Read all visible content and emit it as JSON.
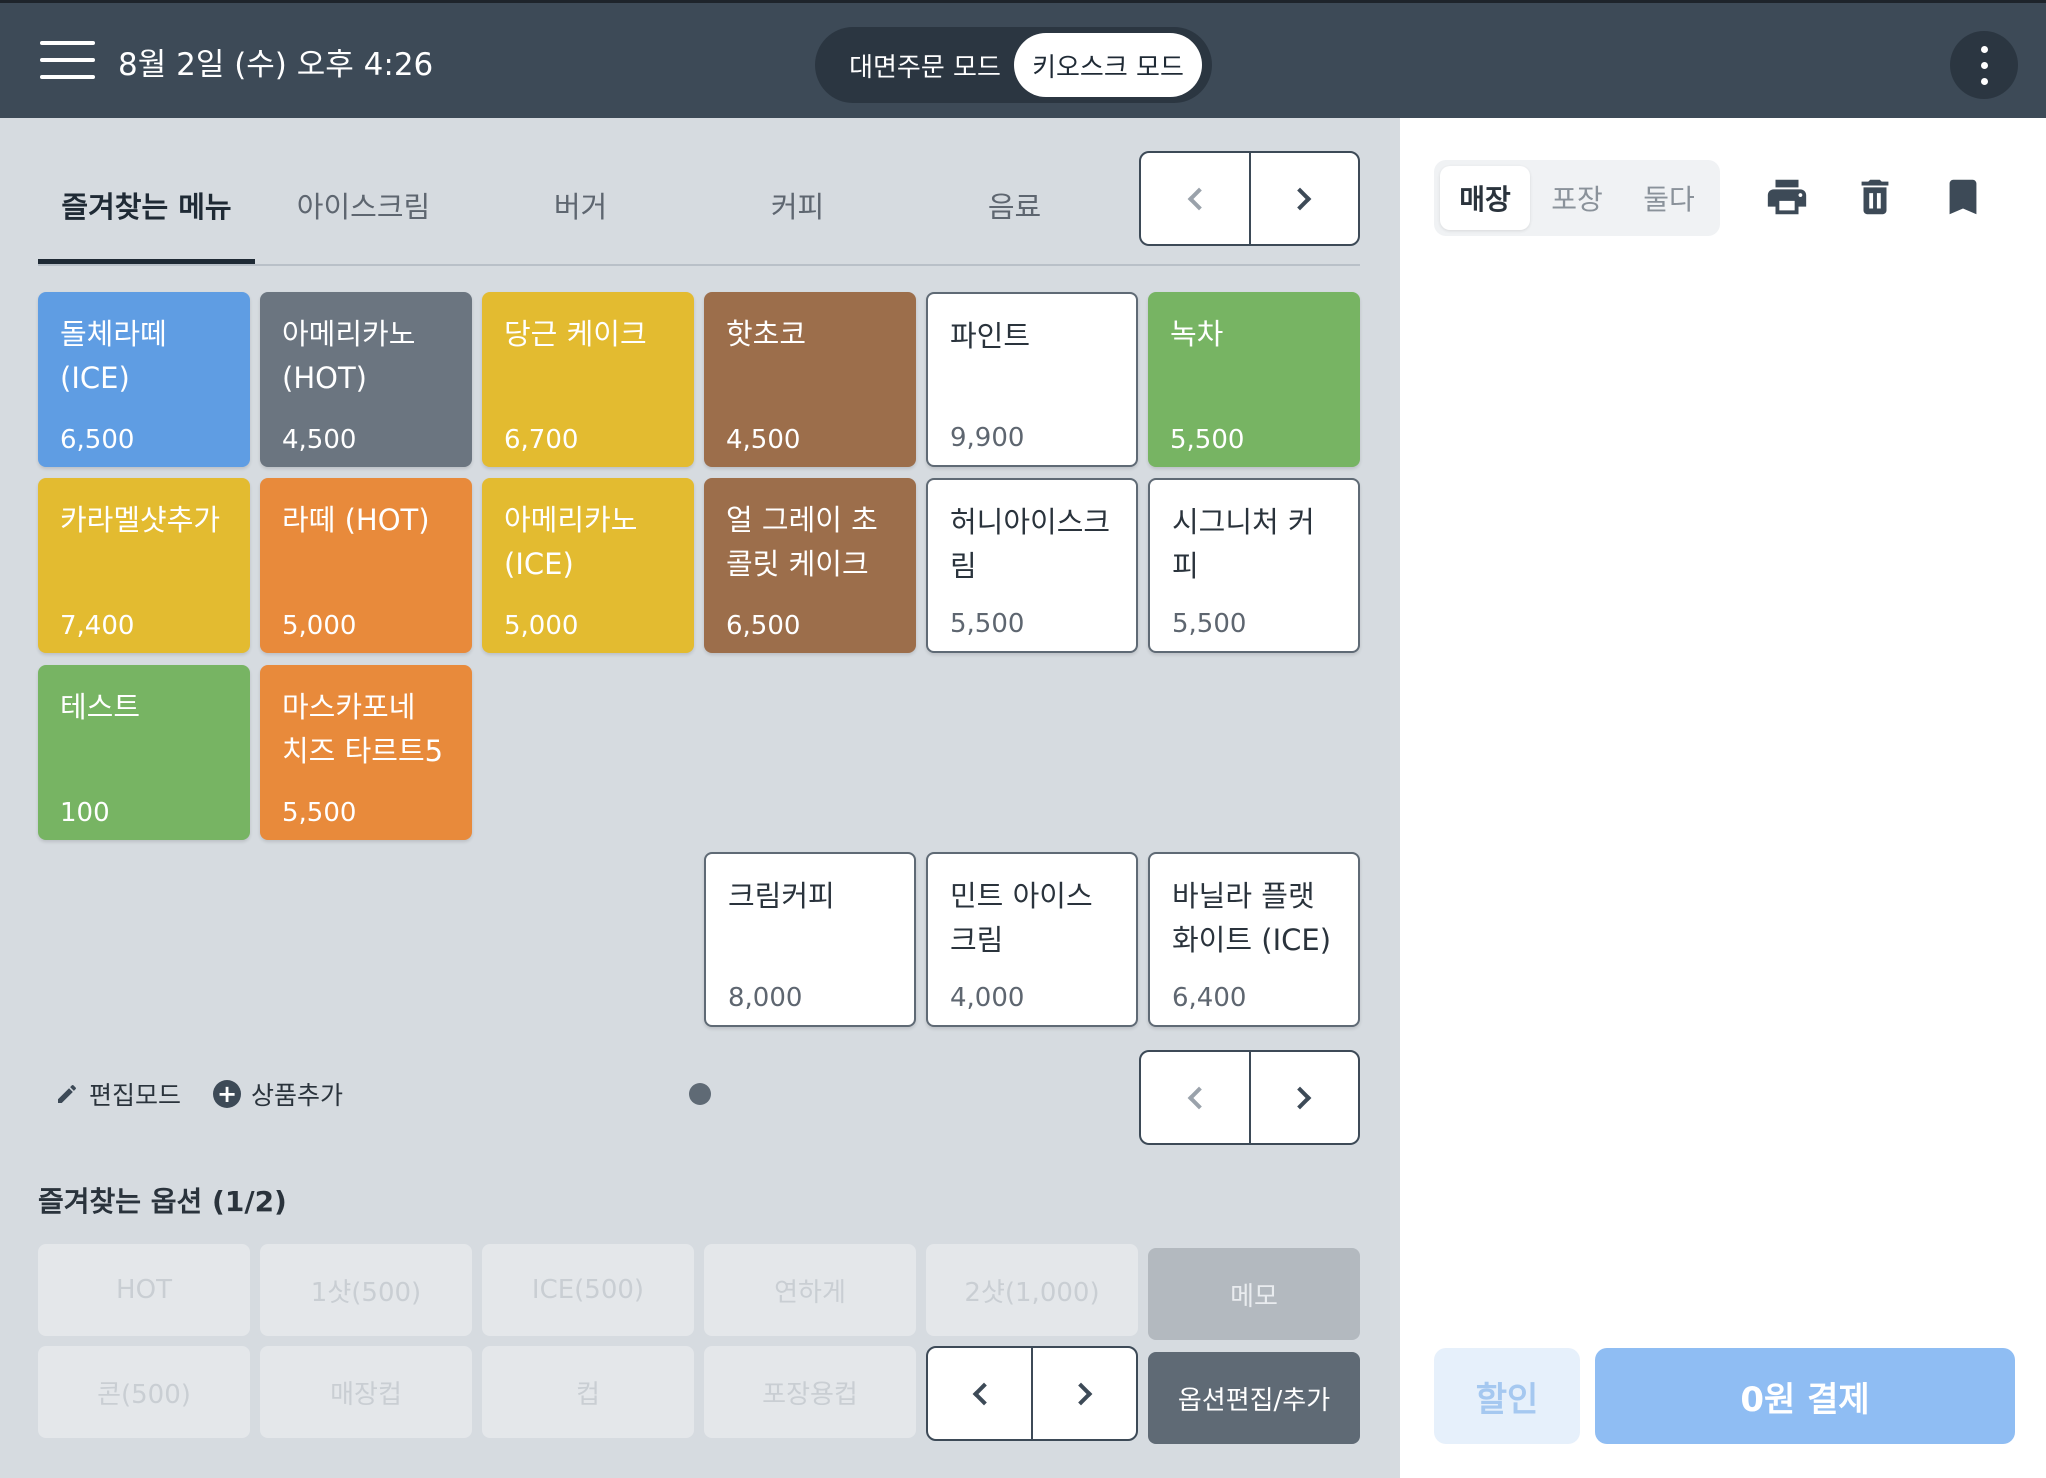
{
  "header": {
    "datetime": "8월 2일 (수) 오후 4:26",
    "mode_face": "대면주문 모드",
    "mode_kiosk": "키오스크 모드"
  },
  "tabs": [
    "즐겨찾는 메뉴",
    "아이스크림",
    "버거",
    "커피",
    "음료"
  ],
  "menu": [
    {
      "name": "돌체라떼 (ICE)",
      "price": "6,500",
      "color": "#5f9de3"
    },
    {
      "name": "아메리카노 (HOT)",
      "price": "4,500",
      "color": "#6b7580"
    },
    {
      "name": "당근 케이크",
      "price": "6,700",
      "color": "#e3bb30"
    },
    {
      "name": "핫초코",
      "price": "4,500",
      "color": "#9c6e4b"
    },
    {
      "name": "파인트",
      "price": "9,900",
      "color": "#ffffff"
    },
    {
      "name": "녹차",
      "price": "5,500",
      "color": "#77b463"
    },
    {
      "name": "카라멜샷추가",
      "price": "7,400",
      "color": "#e3bb30"
    },
    {
      "name": "라떼 (HOT)",
      "price": "5,000",
      "color": "#e88a3b"
    },
    {
      "name": "아메리카노 (ICE)",
      "price": "5,000",
      "color": "#e3bb30"
    },
    {
      "name": "얼 그레이 초콜릿 케이크",
      "price": "6,500",
      "color": "#9c6e4b"
    },
    {
      "name": "허니아이스크림",
      "price": "5,500",
      "color": "#ffffff"
    },
    {
      "name": "시그니처 커피",
      "price": "5,500",
      "color": "#ffffff"
    },
    {
      "name": "테스트",
      "price": "100",
      "color": "#77b463"
    },
    {
      "name": "마스카포네 치즈 타르트5",
      "price": "5,500",
      "color": "#e88a3b"
    },
    {
      "name": "크림커피",
      "price": "8,000",
      "color": "#ffffff"
    },
    {
      "name": "민트 아이스크림",
      "price": "4,000",
      "color": "#ffffff"
    },
    {
      "name": "바닐라 플랫 화이트 (ICE)",
      "price": "6,400",
      "color": "#ffffff"
    }
  ],
  "tools": {
    "edit": "편집모드",
    "add": "상품추가"
  },
  "options": {
    "title": "즐겨찾는 옵션 (1/2)",
    "items": [
      "HOT",
      "1샷(500)",
      "ICE(500)",
      "연하게",
      "2샷(1,000)",
      "콘(500)",
      "매장컵",
      "컵",
      "포장용컵"
    ],
    "memo": "메모",
    "edit": "옵션편집/추가"
  },
  "order": {
    "types": [
      "매장",
      "포장",
      "둘다"
    ],
    "discount": "할인",
    "pay": "0원 결제"
  }
}
